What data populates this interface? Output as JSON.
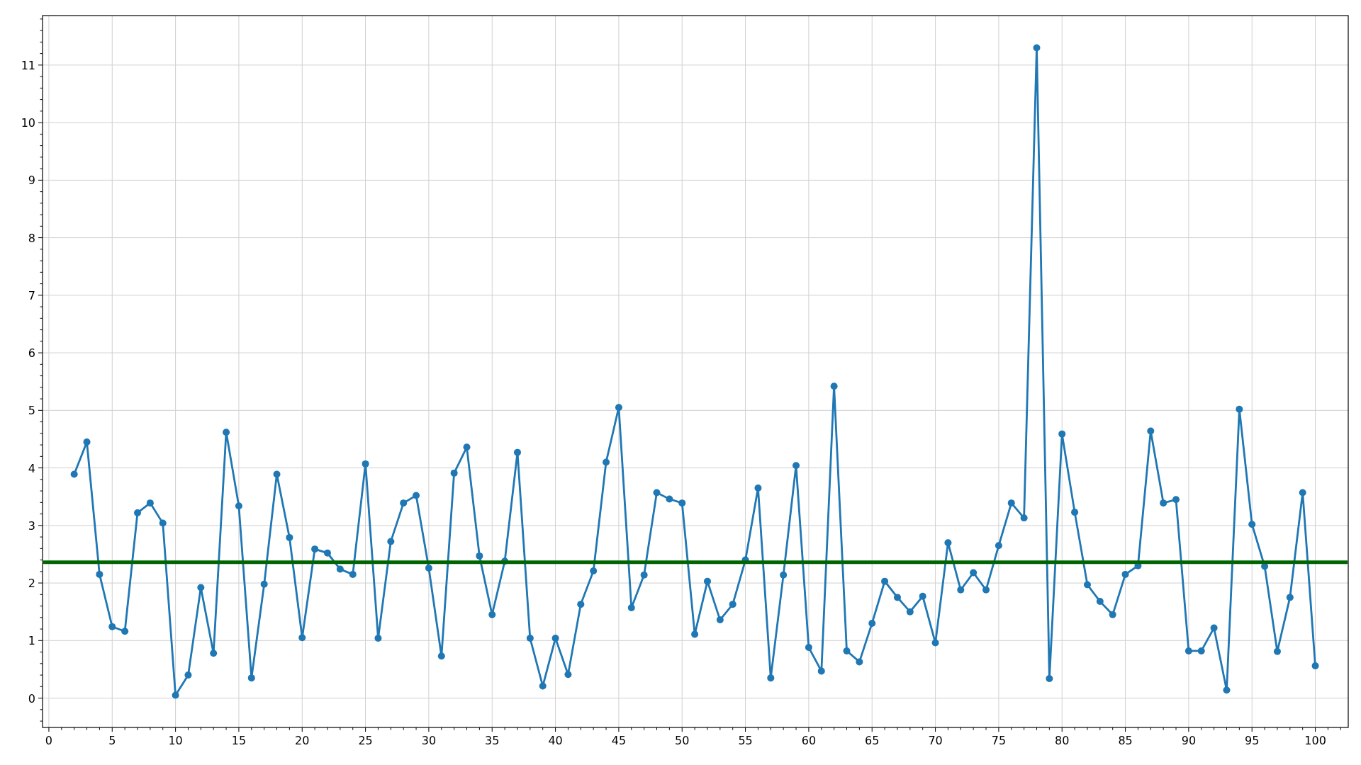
{
  "chart_data": {
    "type": "line",
    "grid": true,
    "x": [
      2,
      3,
      4,
      5,
      6,
      7,
      8,
      9,
      10,
      11,
      12,
      13,
      14,
      15,
      16,
      17,
      18,
      19,
      20,
      21,
      22,
      23,
      24,
      25,
      26,
      27,
      28,
      29,
      30,
      31,
      32,
      33,
      34,
      35,
      36,
      37,
      38,
      39,
      40,
      41,
      42,
      43,
      44,
      45,
      46,
      47,
      48,
      49,
      50,
      51,
      52,
      53,
      54,
      55,
      56,
      57,
      58,
      59,
      60,
      61,
      62,
      63,
      64,
      65,
      66,
      67,
      68,
      69,
      70,
      71,
      72,
      73,
      74,
      75,
      76,
      77,
      78,
      79,
      80,
      81,
      82,
      83,
      84,
      85,
      86,
      87,
      88,
      89,
      90,
      91,
      92,
      93,
      94,
      95,
      96,
      97,
      98,
      99,
      100
    ],
    "series": [
      {
        "color": "#1f77b4",
        "marker": "o",
        "values": [
          3.89,
          4.45,
          2.15,
          1.24,
          1.16,
          3.22,
          3.39,
          3.04,
          0.05,
          0.4,
          1.92,
          0.78,
          4.62,
          3.34,
          0.35,
          1.98,
          3.89,
          2.79,
          1.05,
          2.59,
          2.52,
          2.24,
          2.15,
          4.07,
          1.04,
          2.72,
          3.39,
          3.52,
          2.26,
          0.73,
          3.91,
          4.36,
          2.47,
          1.45,
          2.38,
          4.27,
          1.04,
          0.21,
          1.04,
          0.41,
          1.63,
          2.21,
          4.1,
          5.05,
          1.57,
          2.14,
          3.57,
          3.46,
          3.39,
          1.11,
          2.03,
          1.36,
          1.63,
          2.4,
          3.65,
          0.35,
          2.14,
          4.04,
          0.88,
          0.47,
          5.42,
          0.82,
          0.63,
          1.3,
          2.03,
          1.75,
          1.5,
          1.77,
          0.96,
          2.7,
          1.88,
          2.18,
          1.88,
          2.65,
          3.39,
          3.13,
          11.3,
          0.34,
          4.59,
          3.23,
          1.97,
          1.68,
          1.45,
          2.15,
          2.3,
          4.64,
          3.39,
          3.45,
          0.82,
          0.82,
          1.22,
          0.14,
          5.02,
          3.02,
          2.29,
          0.81,
          1.75,
          3.57,
          0.56
        ]
      }
    ],
    "xlim": [
      -0.5,
      102.6
    ],
    "ylim": [
      -0.51,
      11.86
    ],
    "xticks": [
      0,
      5,
      10,
      15,
      20,
      25,
      30,
      35,
      40,
      45,
      50,
      55,
      60,
      65,
      70,
      75,
      80,
      85,
      90,
      95,
      100
    ],
    "yticks": [
      0,
      1,
      2,
      3,
      4,
      5,
      6,
      7,
      8,
      9,
      10,
      11
    ],
    "ref_lines": [
      {
        "axis": "y",
        "value": 2.36,
        "color": "#006400"
      }
    ]
  }
}
